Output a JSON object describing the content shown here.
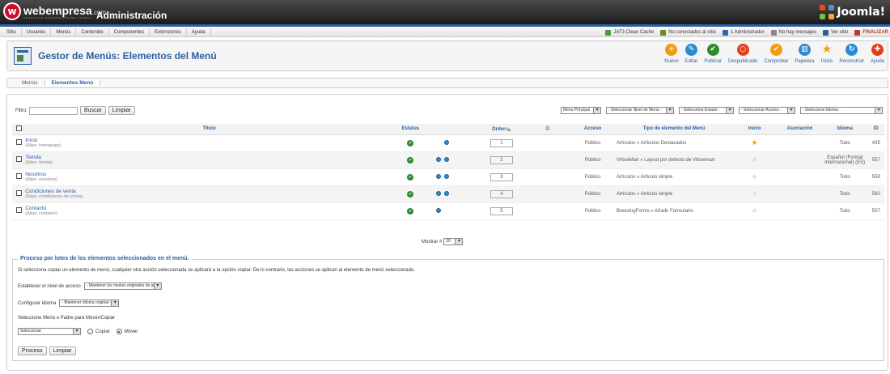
{
  "header": {
    "brand": "webempresa",
    "brand_suffix": ".com",
    "tagline": "SERVICIOS PROFESIONALES JOOMLA",
    "title": "Administración",
    "joomla_logo": "Joomla!"
  },
  "menubar": {
    "items": [
      "Sitio",
      "Usuarios",
      "Menús",
      "Contenido",
      "Componentes",
      "Extensiones",
      "Ayuda"
    ],
    "status": [
      {
        "text": "JAT3 Clean Cache",
        "icon": "cache-icon",
        "color": "#4a9a3a"
      },
      {
        "text": "No conectados al sitio",
        "icon": "users-icon",
        "color": "#6a8a2a"
      },
      {
        "text": "1 Administrador",
        "icon": "admin-icon",
        "color": "#2a6ab0"
      },
      {
        "text": "No hay mensajes",
        "icon": "mail-icon",
        "color": "#888888"
      },
      {
        "text": "Ver sitio",
        "icon": "monitor-icon",
        "color": "#2a5fa0"
      },
      {
        "text": "FINALIZAR",
        "icon": "logout-icon",
        "color": "#c0392b"
      }
    ]
  },
  "toolbar": {
    "title": "Gestor de Menús: Elementos del Menú",
    "buttons": [
      {
        "label": "Nuevo",
        "icon": "new-icon",
        "color": "#f39c12",
        "glyph": "+"
      },
      {
        "label": "Editar",
        "icon": "edit-icon",
        "color": "#2a8bd0",
        "glyph": "✎"
      },
      {
        "label": "Publicar",
        "icon": "publish-icon",
        "color": "#2e8b2e",
        "glyph": "✔"
      },
      {
        "label": "Despublicado",
        "icon": "unpublish-icon",
        "color": "#e0401c",
        "glyph": "○"
      },
      {
        "label": "Comprobar",
        "icon": "checkin-icon",
        "color": "#f39c12",
        "glyph": "✔"
      },
      {
        "label": "Papelera",
        "icon": "trash-icon",
        "color": "#2a8bd0",
        "glyph": "▥"
      },
      {
        "label": "Inicio",
        "icon": "home-star-icon",
        "color": "#f39c12",
        "glyph": "★"
      },
      {
        "label": "Reconstruir",
        "icon": "rebuild-icon",
        "color": "#2a8bd0",
        "glyph": "↻"
      },
      {
        "label": "Ayuda",
        "icon": "help-icon",
        "color": "#e0401c",
        "glyph": "✚"
      }
    ]
  },
  "subnav": {
    "items": [
      "Menús",
      "Elementos Menú"
    ]
  },
  "filters": {
    "label": "Filtro:",
    "search_button": "Buscar",
    "clear_button": "Limpiar",
    "selects": [
      "Menu Principal",
      "- Seleccionar Nivel de Menú -",
      "- Seleccione Estado -",
      "- Seleccionar Acceso -",
      "- Seleccione Idioma -"
    ]
  },
  "table": {
    "headers": {
      "title": "Título",
      "status": "Estatus",
      "order": "Orden",
      "access": "Acceso",
      "type": "Tipo de elemento del Menú",
      "home": "Inicio",
      "assoc": "Asociación",
      "lang": "Idioma",
      "id": "ID"
    },
    "rows": [
      {
        "title": "Inicio",
        "alias": "(Alias: homepage)",
        "order": "1",
        "access": "Público",
        "type": "Artículos » Artículos Destacados",
        "home": true,
        "lang": "Todo",
        "id": "435"
      },
      {
        "title": "Tienda",
        "alias": "(Alias: tienda)",
        "order": "2",
        "access": "Público",
        "type": "VirtueMart » Layout por defecto de Virtuemart",
        "home": false,
        "lang": "Español (Formal Internacional) (ES)",
        "id": "557"
      },
      {
        "title": "Nosotros",
        "alias": "(Alias: nosotros)",
        "order": "3",
        "access": "Público",
        "type": "Artículos » Artículo simple",
        "home": false,
        "lang": "Todo",
        "id": "558"
      },
      {
        "title": "Condiciones de venta",
        "alias": "(Alias: condiciones-de-venta)",
        "order": "4",
        "access": "Público",
        "type": "Artículos » Artículo simple",
        "home": false,
        "lang": "Todo",
        "id": "560"
      },
      {
        "title": "Contacto",
        "alias": "(Alias: contacto)",
        "order": "5",
        "access": "Público",
        "type": "BreezingForms » Añadir Formulario",
        "home": false,
        "lang": "Todo",
        "id": "507"
      }
    ]
  },
  "pagination": {
    "label": "Mostrar #",
    "value": "20"
  },
  "batch": {
    "legend": "Proceso por lotes de los elementos seleccionados en el menú.",
    "note": "Si selecciona copiar un elemento de menú, cualquier otra acción seleccionada se aplicará a la opción copiar. De lo contrario, las acciones se aplican al elemento de menú seleccionado.",
    "access_label": "Establecer el nivel de acceso",
    "access_value": "- Mantener los niveles originales de acceso -",
    "lang_label": "Configurar idioma",
    "lang_value": "- Mantener idioma original -",
    "move_label": "Seleccione Menú o Padre para Mover/Copiar",
    "move_value": "Seleccionar",
    "copy_label": "Copiar",
    "move_radio_label": "Mover",
    "process_button": "Proceso",
    "clear_button": "Limpiar"
  }
}
